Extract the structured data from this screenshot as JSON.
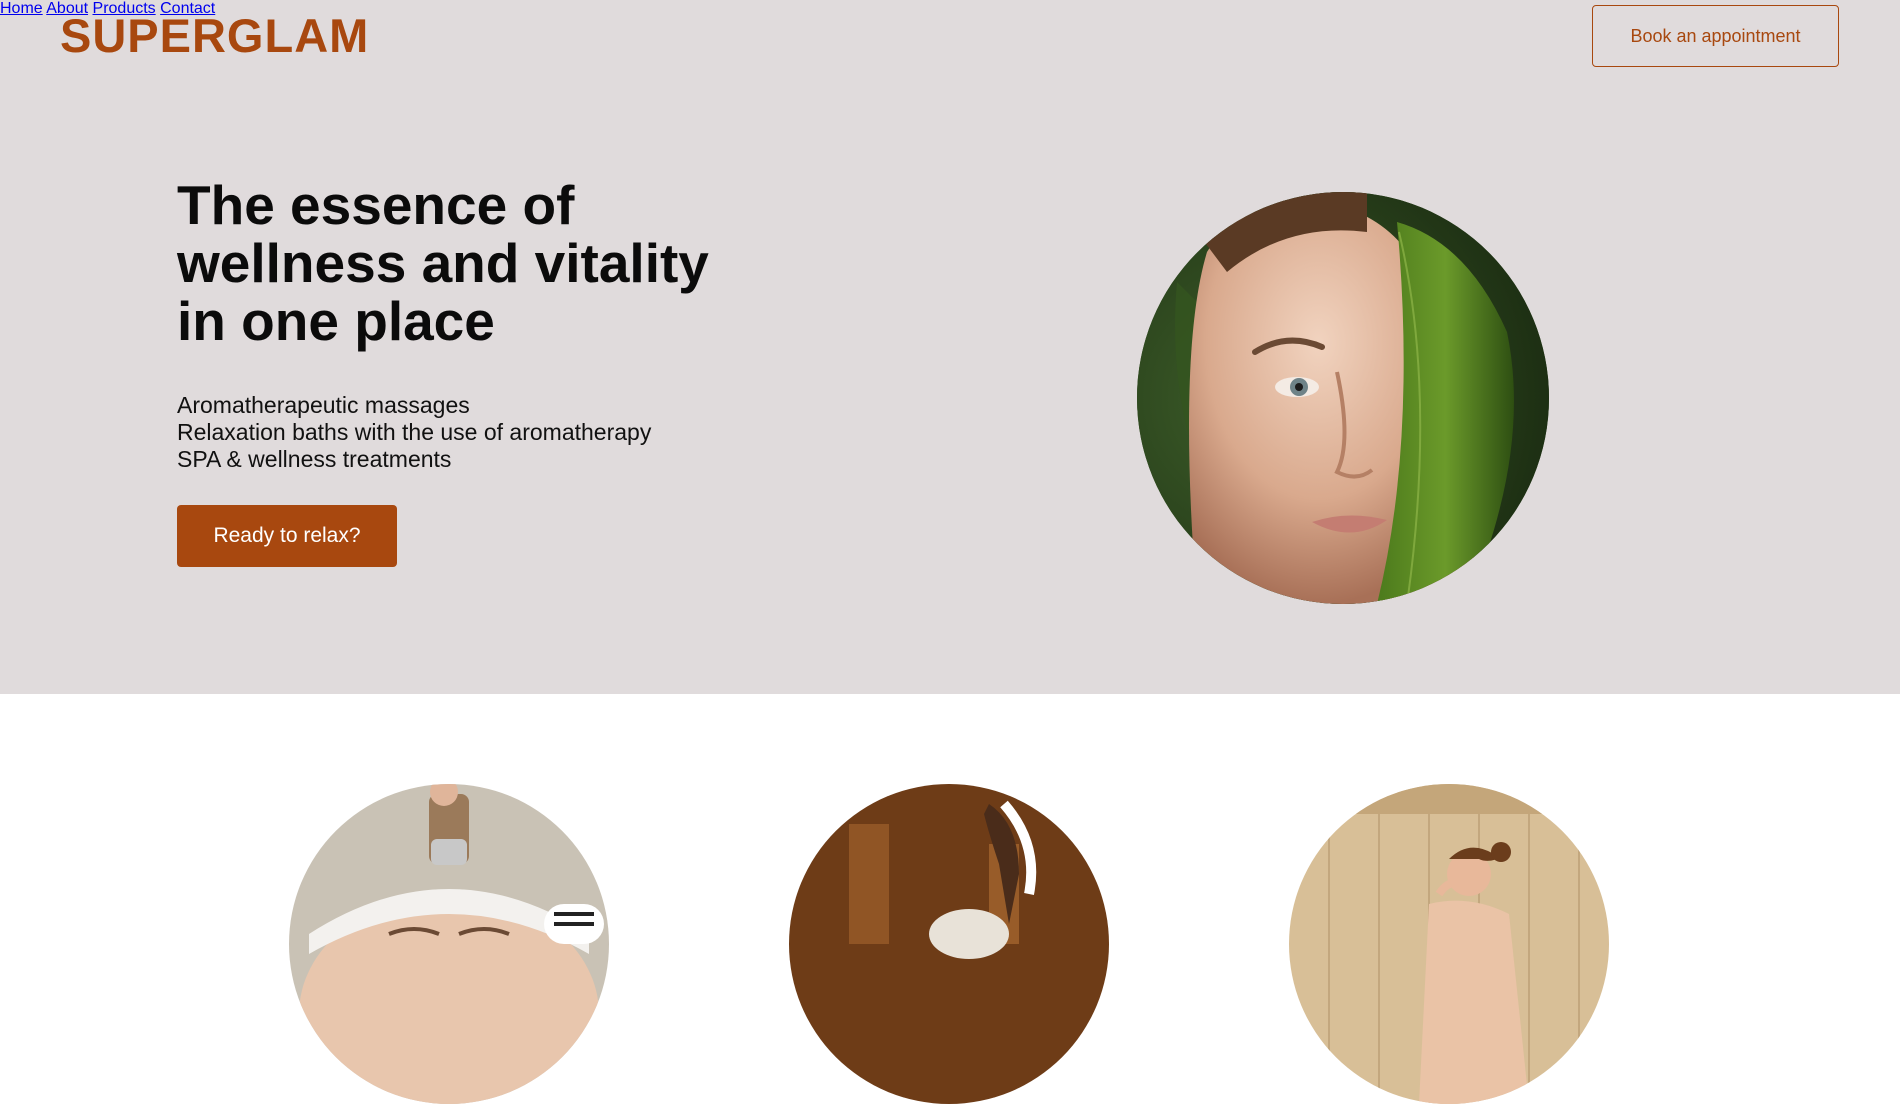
{
  "brand": {
    "name": "SUPERGLAM",
    "accent": "#a8480f",
    "hero_bg": "#e0dbdc"
  },
  "nav": {
    "items": [
      {
        "label": "Home"
      },
      {
        "label": "About"
      },
      {
        "label": "Products"
      },
      {
        "label": "Contact"
      }
    ],
    "book_label": "Book an appointment"
  },
  "hero": {
    "headline_lines": [
      "The essence of",
      "wellness and vitality",
      "in one place"
    ],
    "features": [
      "Aromatherapeutic massages",
      "Relaxation baths with the use of aromatherapy",
      "SPA & wellness treatments"
    ],
    "cta_label": "Ready to relax?",
    "photo_icon": "woman-face-with-leaf-photo"
  },
  "services": {
    "photos": [
      {
        "icon": "facial-roller-treatment-photo"
      },
      {
        "icon": "aromatherapy-massage-photo"
      },
      {
        "icon": "sauna-relaxation-photo"
      }
    ]
  }
}
